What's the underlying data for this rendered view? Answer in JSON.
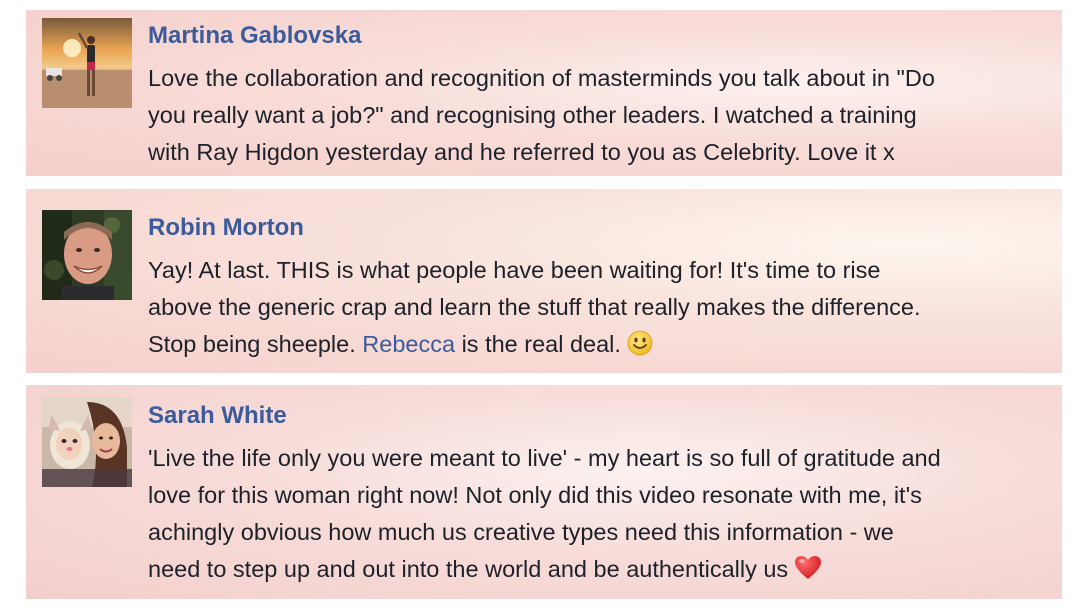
{
  "comments": [
    {
      "author": "Martina Gablovska",
      "avatar_icon": "person-desert-sunset-photo",
      "lines": [
        "Love the collaboration and recognition of masterminds you talk about in \"Do",
        "you really want a job?\" and recognising other leaders. I watched a training",
        "with Ray Higdon yesterday and he referred to you as Celebrity. Love it x"
      ]
    },
    {
      "author": "Robin Morton",
      "avatar_icon": "smiling-man-photo",
      "lines": [
        "Yay! At last. THIS is what people have been waiting for! It's time to rise",
        "above the generic crap and learn the stuff that really makes the difference."
      ],
      "last_line_before": "Stop being sheeple.",
      "mention": "Rebecca",
      "last_line_after": "is the real deal.",
      "emoji": "smiley-emoji"
    },
    {
      "author": "Sarah White",
      "avatar_icon": "two-women-filter-photo",
      "lines": [
        "'Live the life only you were meant to live' - my heart is so full of gratitude and",
        "love for this woman right now! Not only did this video resonate with me, it's",
        "achingly obvious how much us creative types need this information - we"
      ],
      "last_line": "need to step up and out into the world and be authentically us",
      "emoji": "red-heart-emoji"
    }
  ],
  "colors": {
    "author_name": "#3b5b9a",
    "body_text": "#1d2129",
    "card_background": "#f6d6d2"
  }
}
